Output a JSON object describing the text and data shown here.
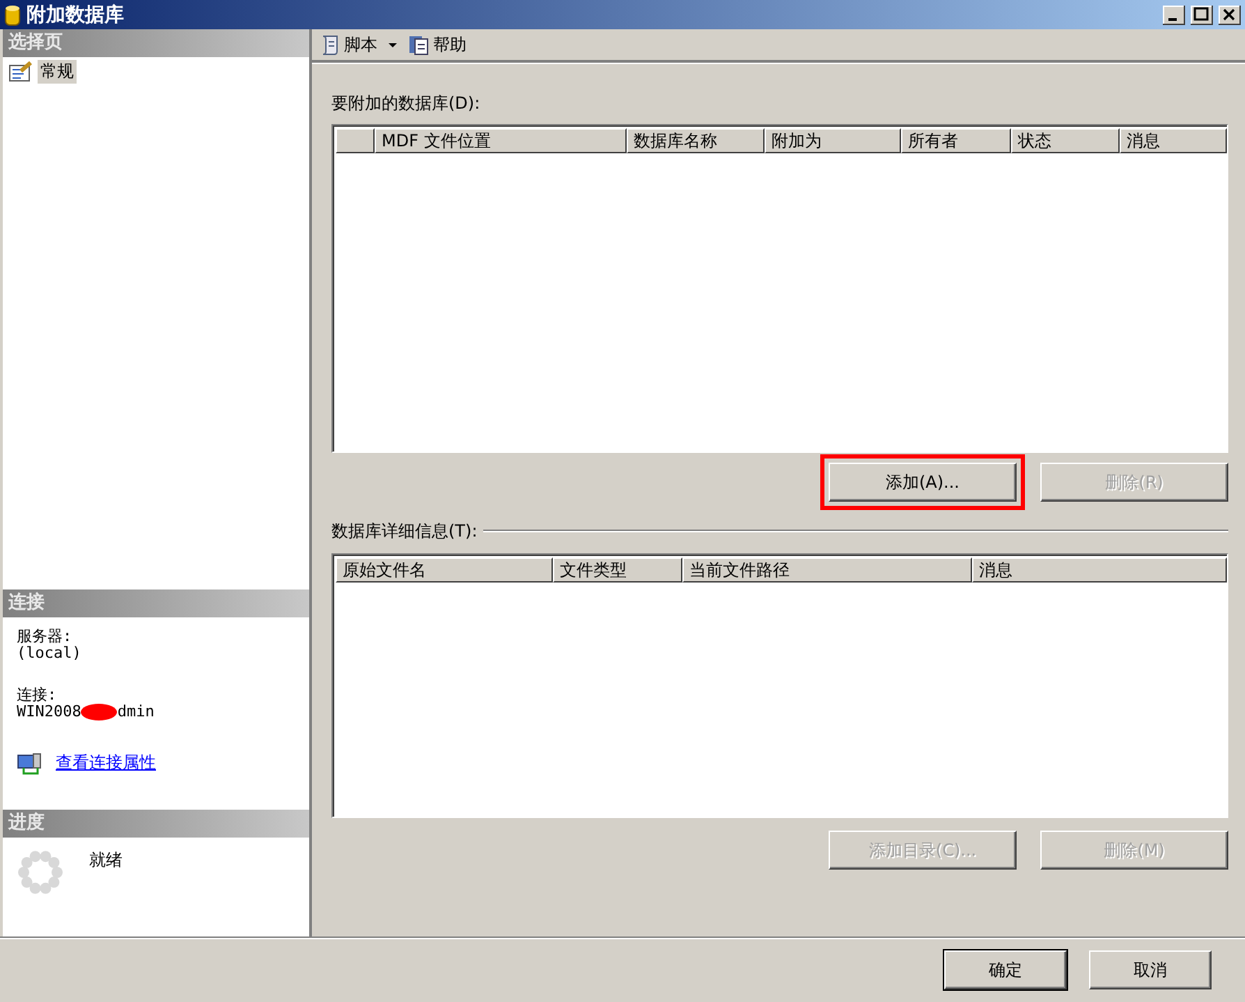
{
  "window": {
    "title": "附加数据库"
  },
  "sidebar": {
    "select_header": "选择页",
    "pages": [
      {
        "label": "常规",
        "selected": true
      }
    ],
    "connection_header": "连接",
    "server_label": "服务器:",
    "server": "(local)",
    "connection_label": "连接:",
    "connection_start": "WIN2008",
    "connection_end": "dmin",
    "link": "查看连接属性",
    "progress_header": "进度",
    "progress_status": "就绪"
  },
  "toolbar": {
    "items": [
      {
        "label": "脚本",
        "kind": "dropdown"
      },
      {
        "label": "帮助",
        "kind": "help"
      }
    ]
  },
  "attach": {
    "label": "要附加的数据库(D):",
    "columns": [
      "MDF 文件位置",
      "数据库名称",
      "附加为",
      "所有者",
      "状态",
      "消息"
    ],
    "buttons": [
      {
        "label": "添加(A)...",
        "disabled": false,
        "highlighted": true
      },
      {
        "label": "删除(R)",
        "disabled": true,
        "highlighted": false
      }
    ]
  },
  "details": {
    "label": "数据库详细信息(T):",
    "columns": [
      "原始文件名",
      "文件类型",
      "当前文件路径",
      "消息"
    ],
    "buttons": [
      {
        "label": "添加目录(C)...",
        "disabled": true
      },
      {
        "label": "删除(M)",
        "disabled": true
      }
    ]
  },
  "footer": {
    "buttons": [
      {
        "label": "确定",
        "disabled": false
      },
      {
        "label": "取消",
        "disabled": false
      }
    ]
  }
}
